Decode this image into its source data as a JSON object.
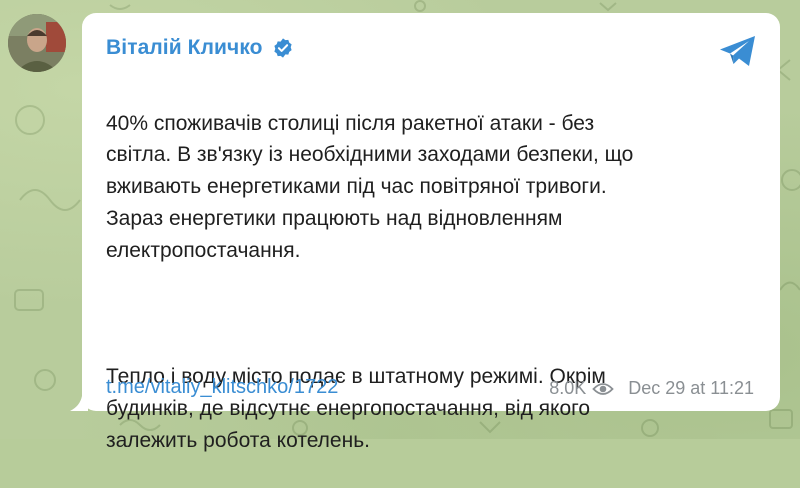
{
  "post": {
    "sender_name": "Віталій Кличко",
    "verified_icon": "verified-badge-icon",
    "share_icon": "telegram-share-icon",
    "paragraph_1": "40% споживачів столиці після ракетної атаки - без\nсвітла. В зв'язку із необхідними заходами безпеки, що\nвживають енергетиками під час повітряної тривоги.\nЗараз енергетики працюють над відновленням\nелектропостачання.",
    "paragraph_2": "Тепло і воду місто подає в штатному режимі. Окрім\nбудинків, де відсутнє енергопостачання, від якого\nзалежить робота котелень.",
    "link": "t.me/vitaliy_klitschko/1722",
    "views": "8.0K",
    "views_icon": "eye-icon",
    "timestamp": "Dec 29 at 11:21"
  },
  "colors": {
    "accent": "#3a8dd3",
    "background": "#b8cc9c",
    "bubble": "#ffffff",
    "meta": "#8a8f93"
  }
}
